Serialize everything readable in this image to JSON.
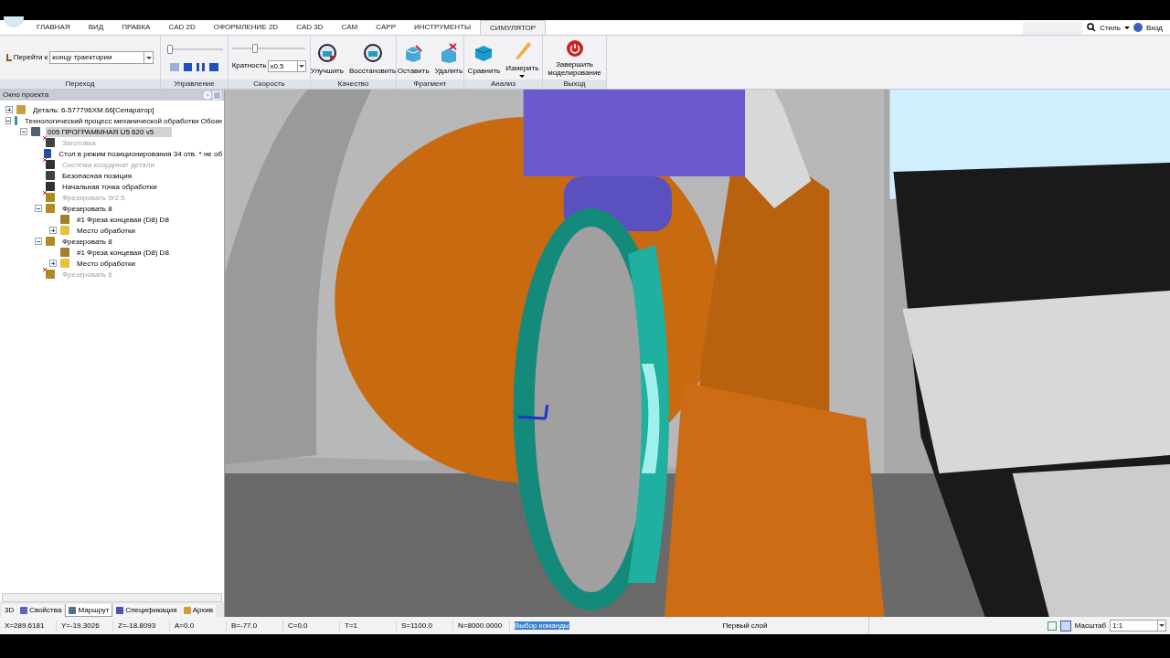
{
  "ribbon_tabs": [
    {
      "label": "ГЛАВНАЯ",
      "selected": false
    },
    {
      "label": "ВИД",
      "selected": false
    },
    {
      "label": "ПРАВКА",
      "selected": false
    },
    {
      "label": "CAD 2D",
      "selected": false
    },
    {
      "label": "ОФОРМЛЕНИЕ 2D",
      "selected": false
    },
    {
      "label": "CAD 3D",
      "selected": false
    },
    {
      "label": "CAM",
      "selected": false
    },
    {
      "label": "CAPP",
      "selected": false
    },
    {
      "label": "ИНСТРУМЕНТЫ",
      "selected": false
    },
    {
      "label": "СИМУЛЯТОР",
      "selected": true
    }
  ],
  "top_right": {
    "style_label": "Стиль",
    "login_label": "Вход"
  },
  "ribbon": {
    "transition": {
      "label": "Перейти к",
      "value": "концу траектории",
      "group": "Переход"
    },
    "control": {
      "level": 0.02,
      "group": "Управление"
    },
    "speed": {
      "level": 0.3,
      "label": "Кратность",
      "value": "x0.5",
      "group": "Скорость"
    },
    "quality": {
      "buttons": [
        {
          "label": "Улучшить",
          "kind": "improve"
        },
        {
          "label": "Восстановить",
          "kind": "restore"
        }
      ],
      "group": "Качество"
    },
    "fragment": {
      "buttons": [
        {
          "label": "Оставить",
          "kind": "keep"
        },
        {
          "label": "Удалить",
          "kind": "delete"
        }
      ],
      "group": "Фрагмент"
    },
    "analysis": {
      "buttons": [
        {
          "label": "Сравнить",
          "kind": "compare"
        },
        {
          "label": "Измерить",
          "kind": "measure"
        }
      ],
      "group": "Анализ"
    },
    "exit": {
      "label": "Завершить моделирование",
      "group": "Выход"
    }
  },
  "project_panel": {
    "title": "Окно проекта",
    "tree": [
      {
        "label": "Деталь: 6-577796ХМ.66[Сепаратор]",
        "kind": "part",
        "expanded": false,
        "disabled": false,
        "selected": false
      },
      {
        "label": "Технологический процесс механической обработки  Обозн",
        "kind": "process",
        "expanded": true,
        "disabled": false,
        "selected": false,
        "children": [
          {
            "label": "005  ПРОГРАММНАЯ U5 620 v5",
            "kind": "program",
            "expanded": true,
            "disabled": false,
            "selected": true,
            "children": [
              {
                "label": "Заготовка",
                "kind": "stock",
                "disabled": true,
                "selected": false
              },
              {
                "label": "Стол в режим позиционирования 34 отв. * не об",
                "kind": "table",
                "disabled": false,
                "selected": false
              },
              {
                "label": "Система координат детали",
                "kind": "coord",
                "disabled": true,
                "selected": false
              },
              {
                "label": "Безопасная позиция",
                "kind": "safe",
                "disabled": false,
                "selected": false
              },
              {
                "label": "Начальная точка обработки",
                "kind": "start",
                "disabled": false,
                "selected": false
              },
              {
                "label": "Фрезеровать 5г2.5",
                "kind": "mill",
                "disabled": true,
                "selected": false
              },
              {
                "label": "Фрезеровать 8",
                "kind": "mill",
                "expanded": true,
                "disabled": false,
                "selected": false,
                "children": [
                  {
                    "label": "#1 Фреза концевая (D8)  D8",
                    "kind": "tool",
                    "disabled": false,
                    "selected": false
                  },
                  {
                    "label": "Место обработки",
                    "kind": "folder",
                    "expanded": false,
                    "disabled": false,
                    "selected": false
                  }
                ]
              },
              {
                "label": "Фрезеровать 8",
                "kind": "mill",
                "expanded": true,
                "disabled": false,
                "selected": false,
                "children": [
                  {
                    "label": "#1 Фреза концевая (D8)  D8",
                    "kind": "tool",
                    "disabled": false,
                    "selected": false
                  },
                  {
                    "label": "Место обработки",
                    "kind": "folder",
                    "expanded": false,
                    "disabled": false,
                    "selected": false
                  }
                ]
              },
              {
                "label": "Фрезеровать 6",
                "kind": "mill",
                "disabled": true,
                "selected": false
              }
            ]
          }
        ]
      }
    ],
    "tabs": [
      {
        "label": "3D",
        "kind": "plain",
        "selected": false
      },
      {
        "label": "Свойства",
        "kind": "props",
        "selected": false
      },
      {
        "label": "Маршрут",
        "kind": "route",
        "selected": true
      },
      {
        "label": "Спецификация",
        "kind": "spec",
        "selected": false
      },
      {
        "label": "Архив",
        "kind": "archive",
        "selected": false
      }
    ]
  },
  "status_bar": {
    "fields": [
      {
        "text": "X=289.6181",
        "selected": false
      },
      {
        "text": "Y=-19.3026",
        "selected": false
      },
      {
        "text": "Z=-18.8093",
        "selected": false
      },
      {
        "text": "A=0.0",
        "selected": false
      },
      {
        "text": "B=-77.0",
        "selected": false
      },
      {
        "text": "C=0.0",
        "selected": false
      },
      {
        "text": "T=1",
        "selected": false
      },
      {
        "text": "S=1100.0",
        "selected": false
      },
      {
        "text": "N=8000.0000",
        "selected": false
      },
      {
        "text": "Выбор команды",
        "selected": true
      }
    ],
    "layer": "Первый слой",
    "scale_label": "Масштаб",
    "scale_value": "1:1"
  }
}
